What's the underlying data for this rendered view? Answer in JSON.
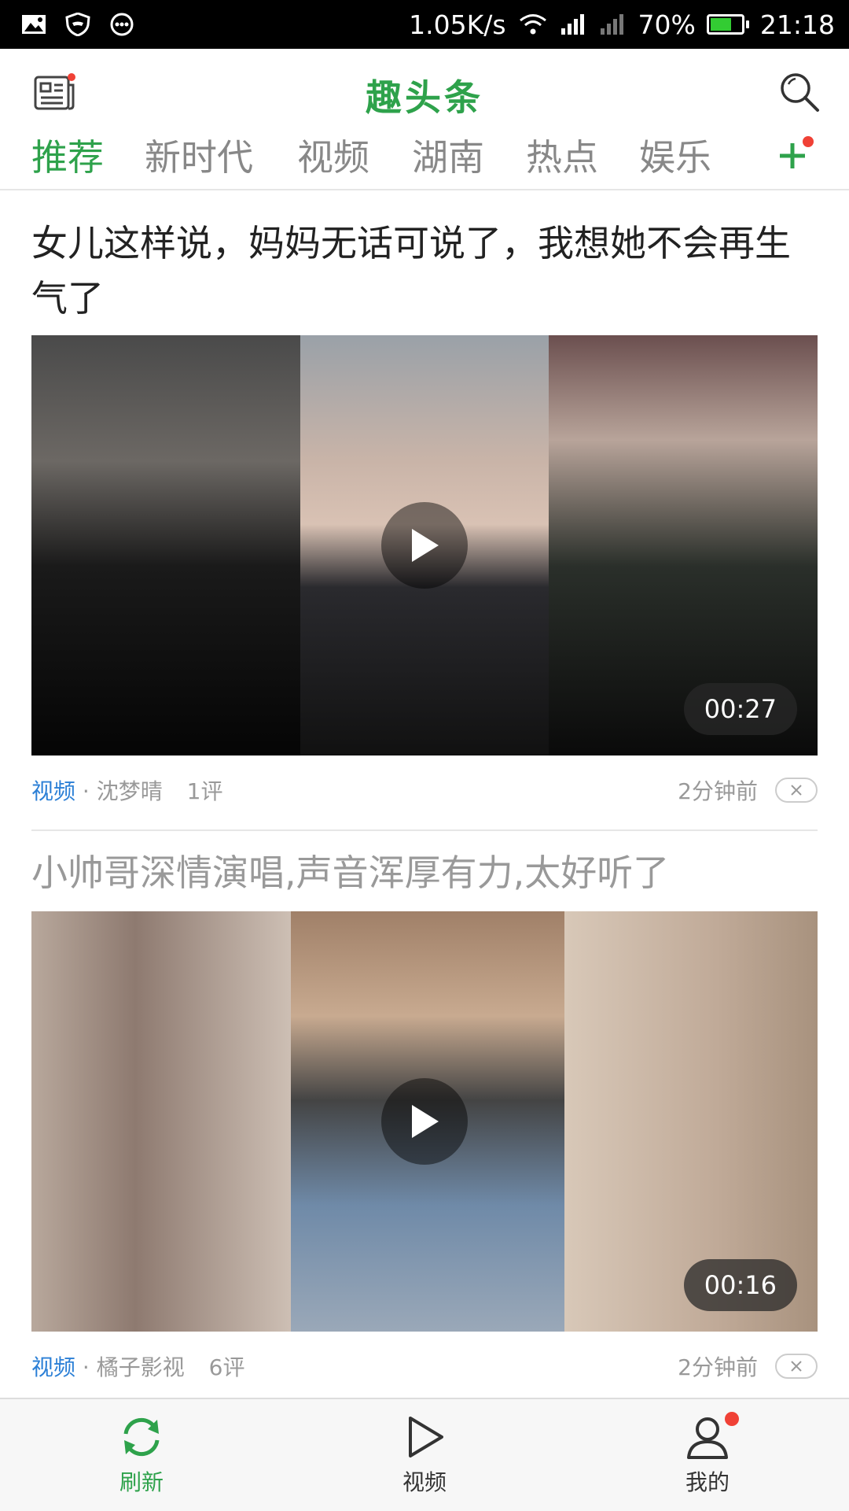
{
  "status_bar": {
    "icons_left": [
      "image-icon",
      "shield-icon",
      "more-icon"
    ],
    "net_speed": "1.05K/s",
    "battery": "70%",
    "time": "21:18"
  },
  "header": {
    "title": "趣头条"
  },
  "tabs": [
    {
      "label": "推荐",
      "active": true
    },
    {
      "label": "新时代"
    },
    {
      "label": "视频"
    },
    {
      "label": "湖南"
    },
    {
      "label": "热点"
    },
    {
      "label": "娱乐"
    }
  ],
  "articles": [
    {
      "title": "女儿这样说，妈妈无话可说了，我想她不会再生气了",
      "category": "视频",
      "source": "沈梦晴",
      "comments": "1评",
      "time": "2分钟前",
      "duration": "00:27"
    },
    {
      "title": "小帅哥深情演唱,声音浑厚有力,太好听了",
      "category": "视频",
      "source": "橘子影视",
      "comments": "6评",
      "time": "2分钟前",
      "duration": "00:16"
    }
  ],
  "bottom_nav": {
    "refresh": "刷新",
    "video": "视频",
    "mine": "我的"
  },
  "colors": {
    "brand": "#2ea24b",
    "category": "#2b7fd6",
    "badge": "#f04136"
  }
}
